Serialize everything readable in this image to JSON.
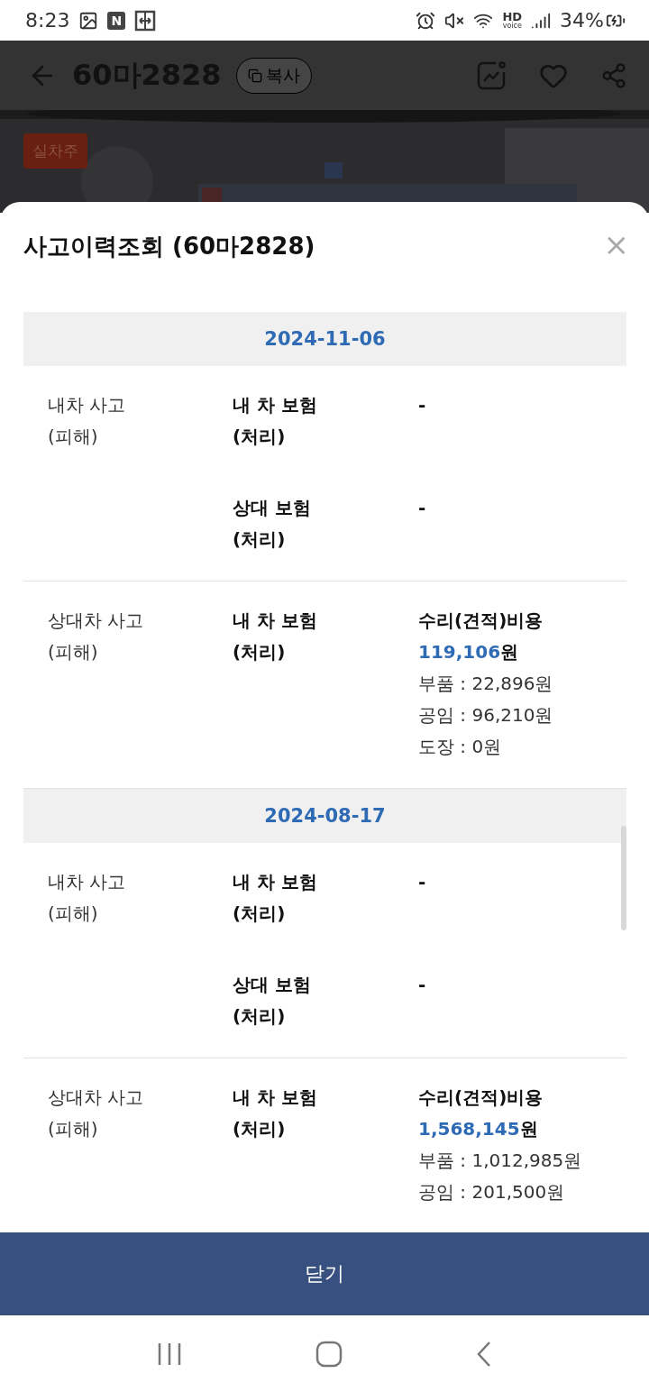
{
  "status_bar": {
    "time": "8:23",
    "notification_letter": "N",
    "hd_label": "HD",
    "hd_sub": "voice",
    "battery": "34%"
  },
  "header": {
    "title": "60마2828",
    "copy_button": "복사"
  },
  "listing": {
    "badge": "실차주"
  },
  "sheet": {
    "title": "사고이력조회 (60마2828)",
    "close": "×",
    "sections": [
      {
        "date": "2024-11-06",
        "entries": [
          {
            "type": "내차 사고",
            "note": "(피해)",
            "rows": [
              {
                "label": "내 차 보험",
                "sub": "(처리)",
                "kind": "dash",
                "value": "-"
              },
              {
                "label": "상대 보험",
                "sub": "(처리)",
                "kind": "dash",
                "value": "-"
              }
            ]
          },
          {
            "type": "상대차 사고",
            "note": "(피해)",
            "rows": [
              {
                "label": "내 차 보험",
                "sub": "(처리)",
                "kind": "cost",
                "heading": "수리(견적)비용",
                "amount": "119,106",
                "unit": "원",
                "lines": [
                  "부품 : 22,896원",
                  "공임 : 96,210원",
                  "도장 : 0원"
                ]
              }
            ]
          }
        ]
      },
      {
        "date": "2024-08-17",
        "entries": [
          {
            "type": "내차 사고",
            "note": "(피해)",
            "rows": [
              {
                "label": "내 차 보험",
                "sub": "(처리)",
                "kind": "dash",
                "value": "-"
              },
              {
                "label": "상대 보험",
                "sub": "(처리)",
                "kind": "dash",
                "value": "-"
              }
            ]
          },
          {
            "type": "상대차 사고",
            "note": "(피해)",
            "rows": [
              {
                "label": "내 차 보험",
                "sub": "(처리)",
                "kind": "cost",
                "heading": "수리(견적)비용",
                "amount": "1,568,145",
                "unit": "원",
                "lines": [
                  "부품 : 1,012,985원",
                  "공임 : 201,500원"
                ]
              }
            ]
          }
        ]
      }
    ]
  },
  "close_button": "닫기"
}
